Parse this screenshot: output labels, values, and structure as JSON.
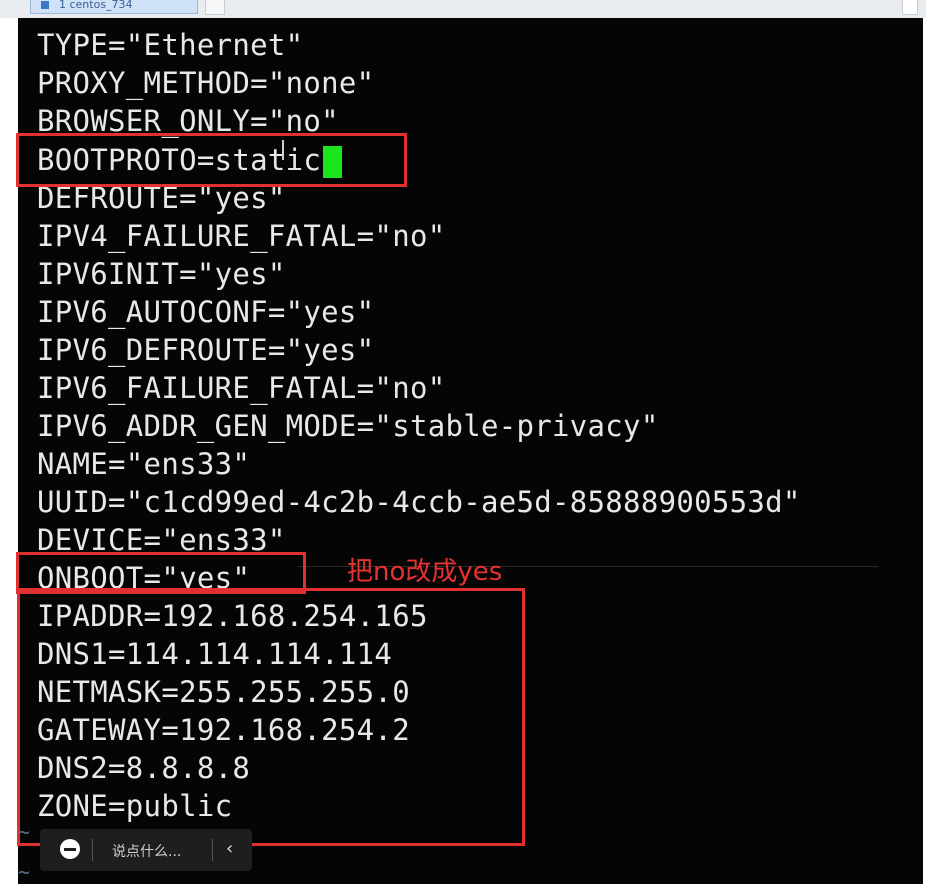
{
  "tab": {
    "title": "1 centos_734"
  },
  "lines": [
    "TYPE=\"Ethernet\"",
    "PROXY_METHOD=\"none\"",
    "BROWSER_ONLY=\"no\"",
    "BOOTPROTO=static",
    "DEFROUTE=\"yes\"",
    "IPV4_FAILURE_FATAL=\"no\"",
    "IPV6INIT=\"yes\"",
    "IPV6_AUTOCONF=\"yes\"",
    "IPV6_DEFROUTE=\"yes\"",
    "IPV6_FAILURE_FATAL=\"no\"",
    "IPV6_ADDR_GEN_MODE=\"stable-privacy\"",
    "NAME=\"ens33\"",
    "UUID=\"c1cd99ed-4c2b-4ccb-ae5d-85888900553d\"",
    "DEVICE=\"ens33\"",
    "ONBOOT=\"yes\"",
    "IPADDR=192.168.254.165",
    "DNS1=114.114.114.114",
    "NETMASK=255.255.255.0",
    "GATEWAY=192.168.254.2",
    "DNS2=8.8.8.8",
    "ZONE=public"
  ],
  "annotation": {
    "note": "把no改成yes"
  },
  "toolbar": {
    "placeholder": "说点什么...",
    "collapse_glyph": "‹"
  },
  "tilde": "~",
  "colors": {
    "terminal_bg": "#050505",
    "text": "#e8e8e8",
    "cursor": "#19e61b",
    "highlight": "#e03030"
  }
}
